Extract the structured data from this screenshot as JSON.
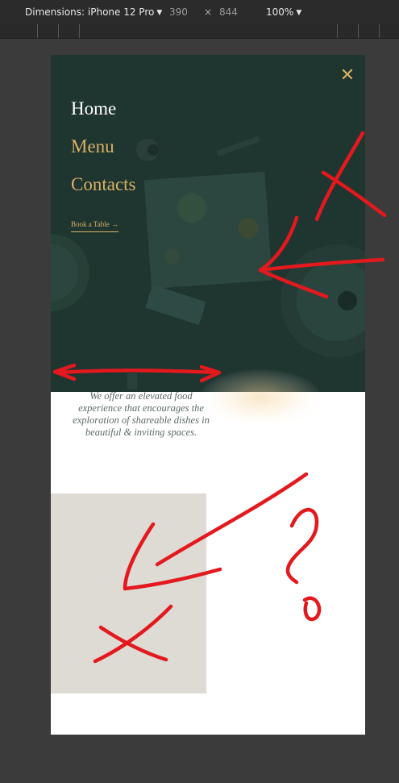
{
  "devtools": {
    "device_label": "Dimensions: iPhone 12 Pro",
    "width_value": "390",
    "times_symbol": "×",
    "height_value": "844",
    "zoom_label": "100%"
  },
  "menu": {
    "close_icon": "close-icon",
    "close_symbol": "✕",
    "items": [
      {
        "label": "Home"
      },
      {
        "label": "Menu"
      },
      {
        "label": "Contacts"
      }
    ],
    "book_label": "Book a Table →"
  },
  "content": {
    "tagline": "We offer an elevated food experience that encourages the exploration of shareable dishes in beautiful & inviting spaces."
  },
  "colors": {
    "hero_bg": "#1f3530",
    "accent_gold": "#d7b364",
    "placeholder_bg": "#dedad4",
    "annotation_red": "#e3191e"
  }
}
